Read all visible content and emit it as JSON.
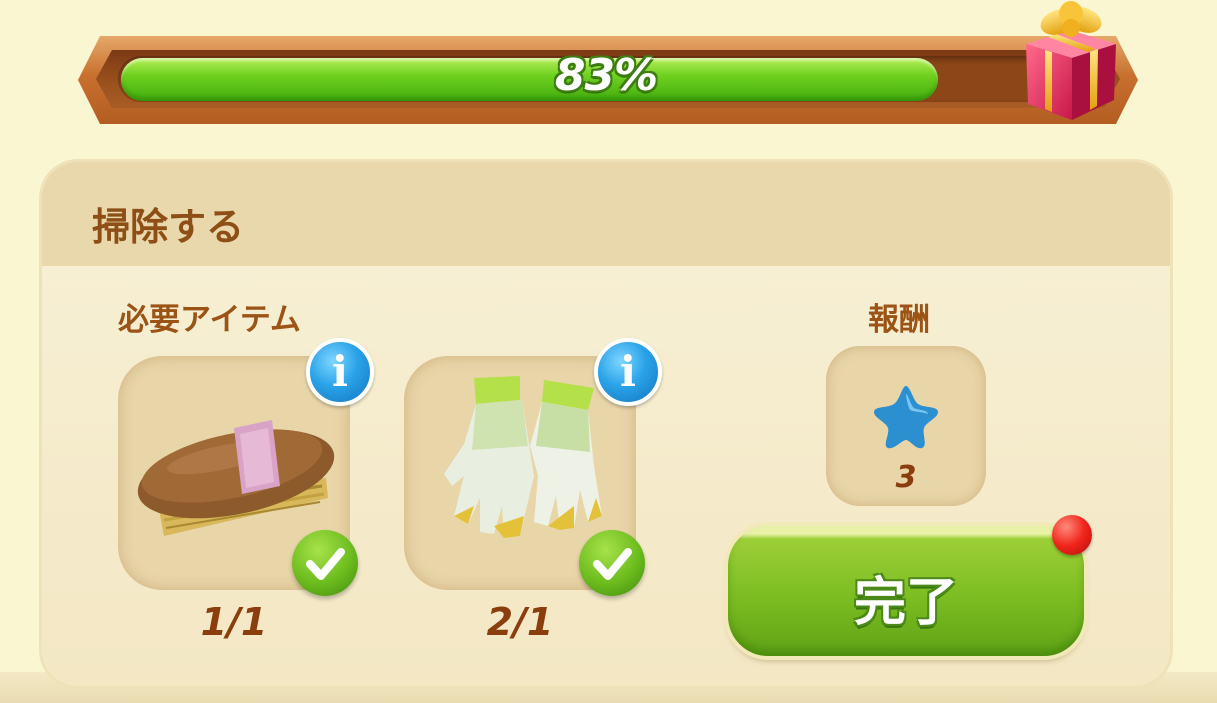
{
  "progress": {
    "percent": 83,
    "label": "83%",
    "colors": {
      "fill": "#6fd11f",
      "frame": "#c7702f"
    },
    "reward_icon": "gift-box-icon"
  },
  "task": {
    "title": "掃除する",
    "required_heading": "必要アイテム",
    "reward_heading": "報酬",
    "items": [
      {
        "icon": "brush-icon",
        "count": "1/1",
        "info_icon": "info-icon",
        "status_icon": "check-icon"
      },
      {
        "icon": "gloves-icon",
        "count": "2/1",
        "info_icon": "info-icon",
        "status_icon": "check-icon"
      }
    ],
    "reward": {
      "icon": "blue-star-icon",
      "count": "3"
    },
    "complete_button": {
      "label": "完了",
      "notification": true
    }
  }
}
